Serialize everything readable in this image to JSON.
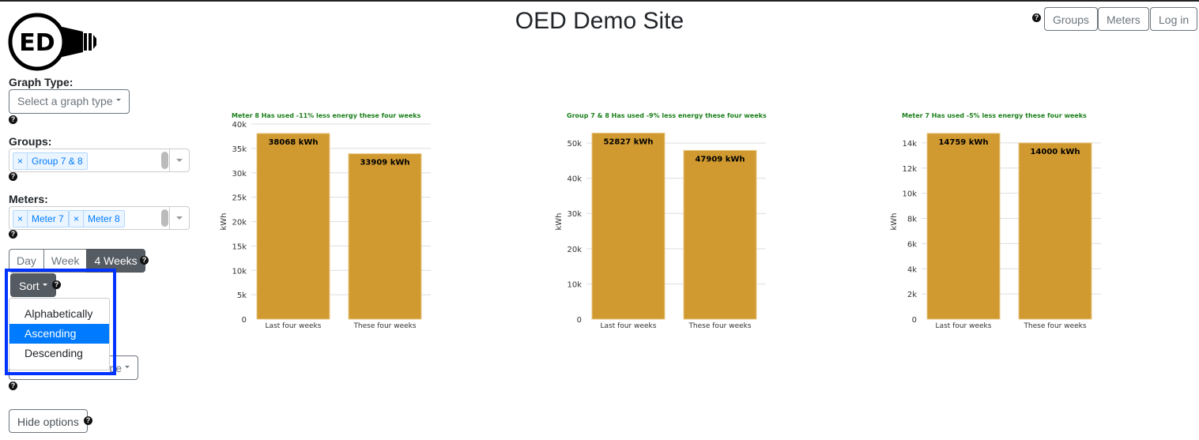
{
  "header": {
    "title": "OED Demo Site",
    "logo_text": "ED",
    "nav": [
      "Groups",
      "Meters",
      "Log in"
    ],
    "help_icon": "question-circle-icon"
  },
  "sidebar": {
    "graph_type_label": "Graph Type:",
    "graph_type_placeholder": "Select a graph type",
    "groups_label": "Groups:",
    "groups_selected": [
      "Group 7 & 8"
    ],
    "meters_label": "Meters:",
    "meters_selected": [
      "Meter 7",
      "Meter 8"
    ],
    "chip_remove": "×",
    "time_intervals": [
      "Day",
      "Week",
      "4 Weeks"
    ],
    "active_interval": "4 Weeks",
    "sort_label": "Sort",
    "sort_options": [
      "Alphabetically",
      "Ascending",
      "Descending"
    ],
    "sort_highlighted": "Ascending",
    "obscured_dropdown_text": "pe",
    "hide_options": "Hide options"
  },
  "colors": {
    "bar": "#d19a30",
    "title": "#1a7f1a",
    "highlight": "#0033ff",
    "accent": "#007bff"
  },
  "chart_data": [
    {
      "type": "bar",
      "title": "Meter 8 Has used -11% less energy these four weeks",
      "ylabel": "kWh",
      "categories": [
        "Last four weeks",
        "These four weeks"
      ],
      "values": [
        38068,
        33909
      ],
      "labels": [
        "38068 kWh",
        "33909 kWh"
      ],
      "ylim": [
        0,
        40000
      ],
      "ticks": [
        0,
        5000,
        10000,
        15000,
        20000,
        25000,
        30000,
        35000,
        40000
      ],
      "tick_labels": [
        "0",
        "5k",
        "10k",
        "15k",
        "20k",
        "25k",
        "30k",
        "35k",
        "40k"
      ],
      "grid": true
    },
    {
      "type": "bar",
      "title": "Group 7 & 8 Has used -9% less energy these four weeks",
      "ylabel": "kWh",
      "categories": [
        "Last four weeks",
        "These four weeks"
      ],
      "values": [
        52827,
        47909
      ],
      "labels": [
        "52827 kWh",
        "47909 kWh"
      ],
      "ylim": [
        0,
        55400
      ],
      "ticks": [
        0,
        10000,
        20000,
        30000,
        40000,
        50000
      ],
      "tick_labels": [
        "0",
        "10k",
        "20k",
        "30k",
        "40k",
        "50k"
      ],
      "grid": true
    },
    {
      "type": "bar",
      "title": "Meter 7 Has used -5% less energy these four weeks",
      "ylabel": "kWh",
      "categories": [
        "Last four weeks",
        "These four weeks"
      ],
      "values": [
        14759,
        14000
      ],
      "labels": [
        "14759 kWh",
        "14000 kWh"
      ],
      "ylim": [
        0,
        15500
      ],
      "ticks": [
        0,
        2000,
        4000,
        6000,
        8000,
        10000,
        12000,
        14000
      ],
      "tick_labels": [
        "0",
        "2k",
        "4k",
        "6k",
        "8k",
        "10k",
        "12k",
        "14k"
      ],
      "grid": true
    }
  ]
}
